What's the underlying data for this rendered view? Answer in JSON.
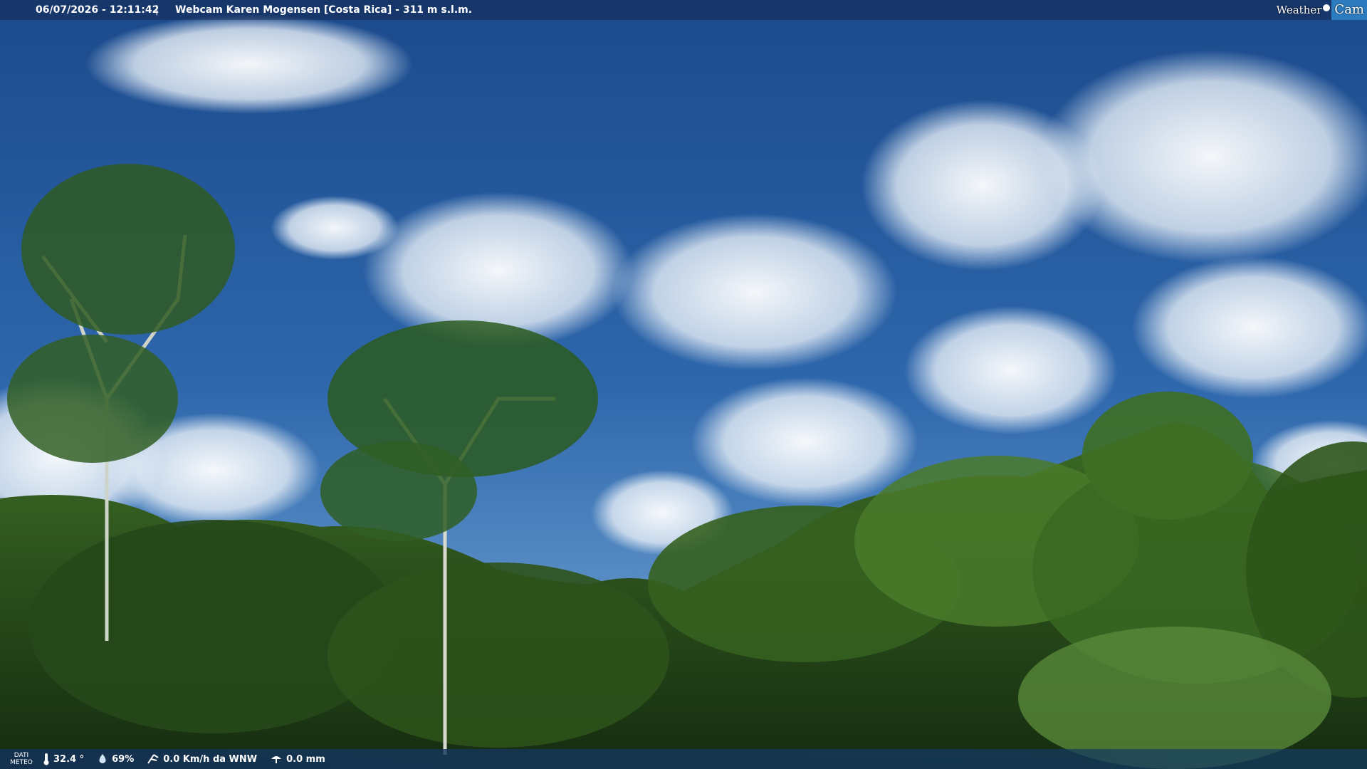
{
  "header": {
    "datetime": "06/07/2026 - 12:11:42",
    "separator": "|",
    "title": "Webcam Karen Mogensen [Costa Rica]  - 311 m s.l.m.",
    "logo_weather": "Weather",
    "logo_cam": "Cam"
  },
  "footer": {
    "label_line1": "DATI",
    "label_line2": "METEO",
    "temperature": "32.4 °",
    "humidity": "69%",
    "wind": "0.0 Km/h da WNW",
    "rain": "0.0 mm"
  },
  "colors": {
    "sky_top": "#1a4a8a",
    "sky_bottom": "#4a86c6",
    "foliage_dark": "#1c3a16",
    "foliage_light": "#4c7a2c"
  }
}
